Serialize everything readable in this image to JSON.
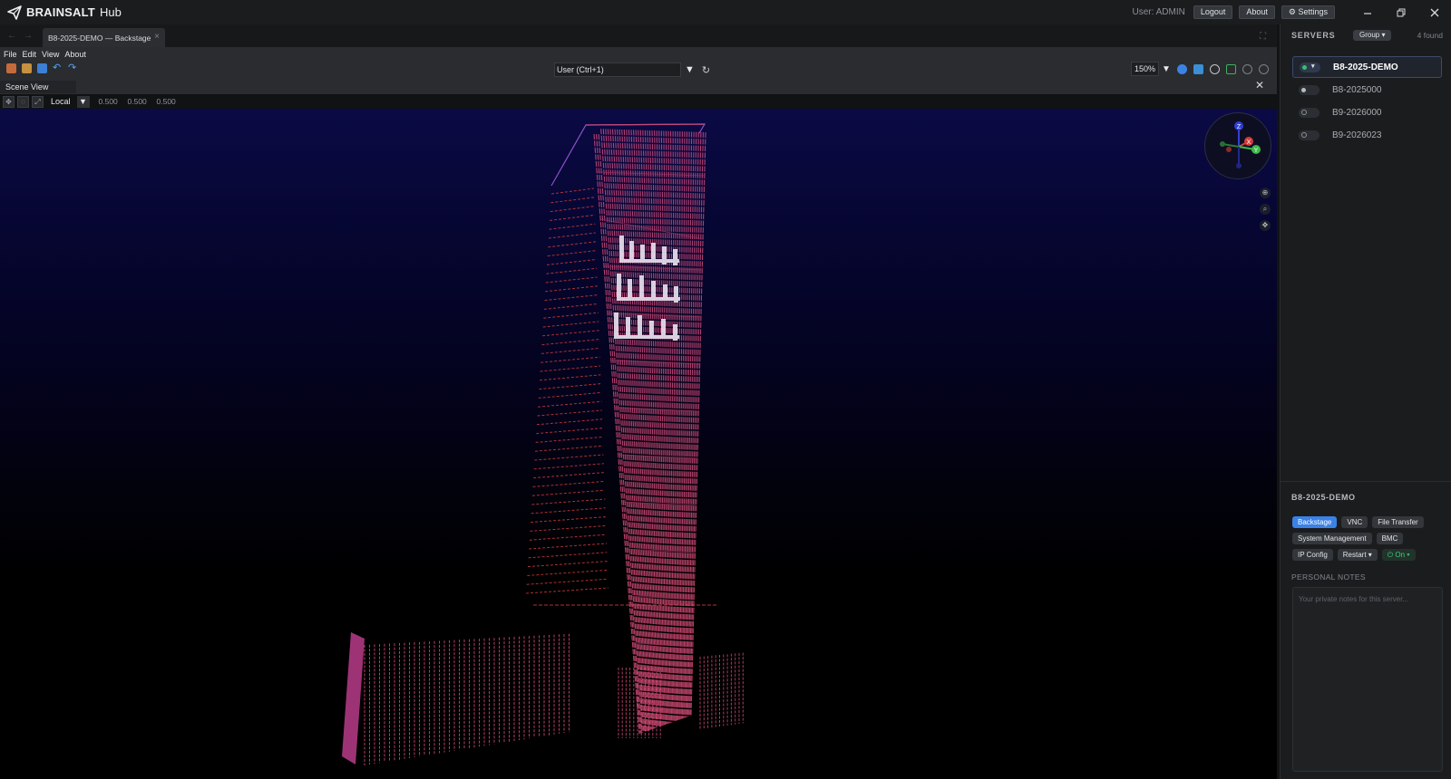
{
  "app": {
    "brand_bold": "BRAINSALT",
    "brand_light": "Hub"
  },
  "titlebar": {
    "user_label": "User: ADMIN",
    "logout_label": "Logout",
    "about_label": "About",
    "settings_label": "⚙ Settings"
  },
  "tabs": {
    "document": "B8-2025-DEMO — Backstage"
  },
  "menu": {
    "items": [
      "File",
      "Edit",
      "View",
      "About"
    ]
  },
  "toolbar": {
    "mode": "User  (Ctrl+1)",
    "zoom": "150%",
    "scene_view_label": "Scene View",
    "space": "Local",
    "values": [
      "0.500",
      "0.500",
      "0.500"
    ]
  },
  "gizmo": {
    "axes": [
      "Z",
      "X",
      "Y"
    ]
  },
  "servers": {
    "title": "SERVERS",
    "group_label": "Group ▾",
    "found": "4 found",
    "items": [
      {
        "name": "B8-2025-DEMO",
        "active": true
      },
      {
        "name": "B8-2025000",
        "active": false
      },
      {
        "name": "B9-2026000",
        "active": false
      },
      {
        "name": "B9-2026023",
        "active": false
      }
    ]
  },
  "detail": {
    "title": "B8-2025-DEMO",
    "actions": [
      "Backstage",
      "VNC",
      "File Transfer",
      "System Management",
      "BMC",
      "IP Config",
      "Restart ▾",
      "⏻ On ▾"
    ],
    "notes_label": "PERSONAL NOTES",
    "notes_placeholder": "Your private notes for this server..."
  },
  "colors": {
    "accent": "#3b82e6",
    "online": "#37c06c",
    "led_pink": "#e0507e",
    "led_red": "#c83a3a",
    "sky_top": "#0b0a45"
  }
}
